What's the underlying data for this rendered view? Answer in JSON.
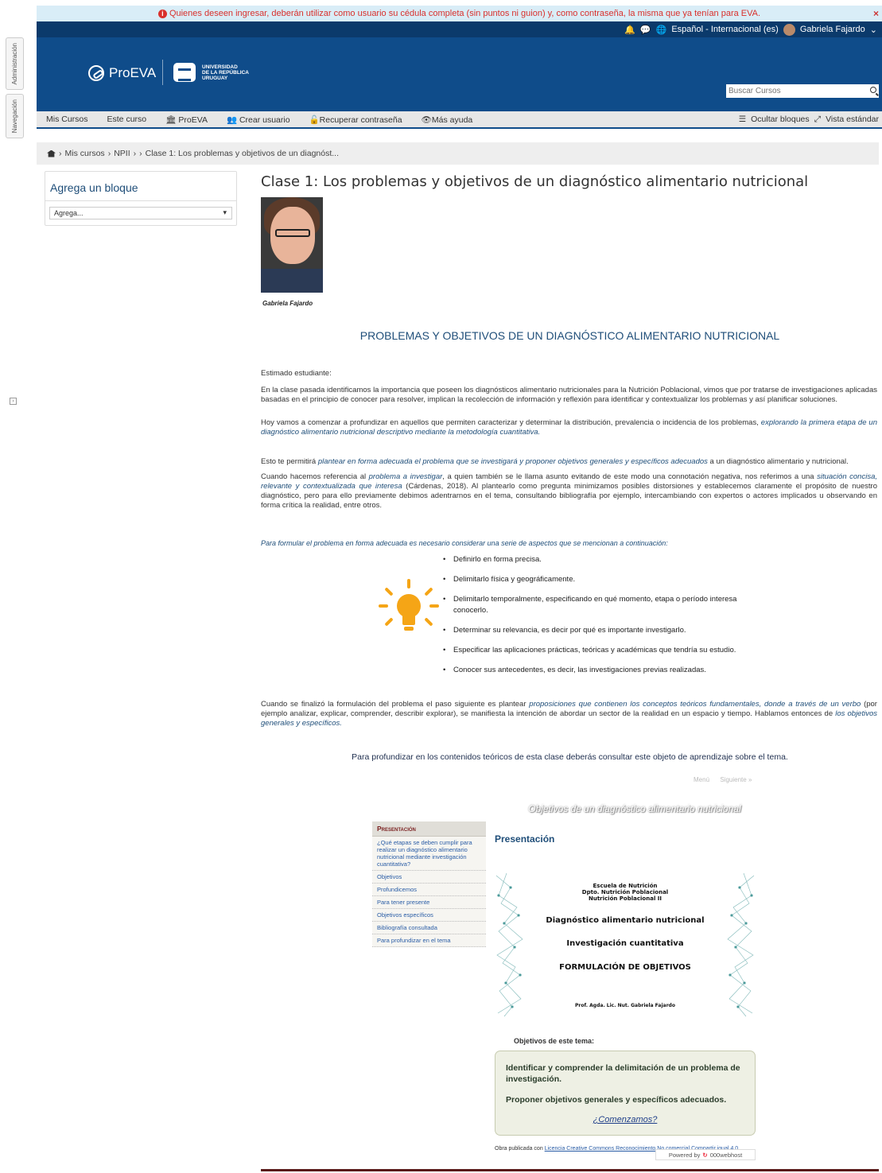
{
  "side_tabs": {
    "admin": "Administración",
    "nav": "Navegación"
  },
  "alert": {
    "text": "Quienes deseen ingresar, deberán utilizar como usuario su cédula completa (sin puntos ni guion) y, como contraseña, la misma que ya tenían para EVA.",
    "close": "×"
  },
  "topbar": {
    "language": "Español - Internacional (es)",
    "user": "Gabriela Fajardo"
  },
  "header": {
    "proeva": "ProEVA",
    "udelar_line1": "UNIVERSIDAD",
    "udelar_line2": "DE LA REPÚBLICA",
    "udelar_line3": "URUGUAY",
    "search_placeholder": "Buscar Cursos"
  },
  "menu": {
    "items": [
      "Mis Cursos",
      "Este curso",
      "ProEVA",
      "Crear usuario",
      "Recuperar contraseña",
      "Más ayuda"
    ],
    "hide_blocks": "Ocultar bloques",
    "standard_view": "Vista estándar"
  },
  "breadcrumb": {
    "items": [
      "Mis cursos",
      "NPII",
      "Clase 1: Los problemas y objetivos de un diagnóst..."
    ]
  },
  "block": {
    "title": "Agrega un bloque",
    "select": "Agrega..."
  },
  "main": {
    "title": "Clase 1: Los problemas y objetivos de un diagnóstico alimentario nutricional",
    "photo_caption": "Gabriela Fajardo",
    "heading": "PROBLEMAS Y OBJETIVOS DE UN DIAGNÓSTICO ALIMENTARIO NUTRICIONAL",
    "greeting": "Estimado estudiante:",
    "p1": "En la clase pasada identificamos la importancia que poseen los diagnósticos alimentario nutricionales para la Nutrición Poblacional, vimos que por tratarse de investigaciones aplicadas basadas en el principio de conocer para resolver,  implican la recolección de información y reflexión para identificar y contextualizar los problemas y así planificar soluciones.",
    "p2_a": "Hoy vamos a comenzar a profundizar en aquellos que permiten caracterizar y determinar la distribución, prevalencia o incidencia de los problemas, ",
    "p2_b": "explorando la primera etapa de un diagnóstico alimentario nutricional descriptivo mediante la metodología cuantitativa.",
    "p3_a": "Esto te permitirá ",
    "p3_b": "plantear en forma adecuada el problema que se investigará y proponer objetivos generales y específicos adecuados",
    "p3_c": " a un diagnóstico alimentario y nutricional.",
    "p4_a": "Cuando hacemos referencia al ",
    "p4_b": "problema a investigar",
    "p4_c": ", a quien también se le llama asunto evitando de este modo una connotación negativa, nos referimos a una ",
    "p4_d": "situación concisa, relevante y contextualizada que interesa",
    "p4_e": " (Cárdenas,  2018). Al plantearlo como pregunta minimizamos posibles distorsiones y establecemos claramente el propósito de nuestro diagnóstico, pero para ello previamente debimos adentrarnos en el tema, consultando bibliografía por ejemplo,  intercambiando con expertos o actores implicados u observando en forma crítica la realidad, entre otros.",
    "lead": "Para formular el problema en forma adecuada es necesario considerar una serie de aspectos que se mencionan a continuación:",
    "bullets": [
      "Definirlo en forma precisa.",
      "Delimitarlo física y geográficamente.",
      "Delimitarlo temporalmente, especificando en qué momento, etapa o período interesa conocerlo.",
      "Determinar su relevancia, es decir por qué es importante investigarlo.",
      "Especificar las aplicaciones prácticas, teóricas y académicas que tendría su estudio.",
      "Conocer sus antecedentes, es decir, las investigaciones previas realizadas."
    ],
    "p5_a": "Cuando se finalizó la formulación del problema el paso siguiente es plantear ",
    "p5_b": "proposiciones que contienen los conceptos teóricos fundamentales, donde a través de un verbo",
    "p5_c": " (por ejemplo analizar, explicar, comprender, describir explorar), se manifiesta la intención de abordar un sector de la realidad en un espacio y tiempo. Hablamos entonces de ",
    "p5_d": "los objetivos generales y específicos.",
    "center_note": "Para profundizar en los contenidos teóricos de esta clase deberás consultar este objeto de aprendizaje sobre el tema."
  },
  "lo": {
    "nav_menu": "Menú",
    "nav_next": "Siguiente »",
    "title": "Objetivos de un diagnóstico alimentario nutricional",
    "menu_head": "Presentación",
    "menu_items": [
      "¿Qué etapas se deben cumplir para realizar un diagnóstico alimentario nutricional mediante investigación cuantitativa?",
      "Objetivos",
      "Profundicemos",
      "Para tener presente",
      "Objetivos específicos",
      "Bibliografía consultada",
      "Para profundizar en el tema"
    ],
    "heading": "Presentación",
    "slide": {
      "school": "Escuela de Nutrición",
      "dept": "Dpto. Nutrición Poblacional",
      "course": "Nutrición Poblacional II",
      "t1": "Diagnóstico alimentario nutricional",
      "t2": "Investigación cuantitativa",
      "t3": "FORMULACIÓN DE OBJETIVOS",
      "author": "Prof. Agda. Lic. Nut. Gabriela Fajardo"
    },
    "sub": "Objetivos de este tema:",
    "obj1": "Identificar y comprender la delimitación de un problema de investigación.",
    "obj2": "Proponer objetivos generales y específicos adecuados.",
    "go": "¿Comenzamos?",
    "foot_a": "Obra publicada con ",
    "foot_link": "Licencia Creative Commons Reconocimiento No comercial Compartir igual 4.0",
    "powered": "Powered by",
    "powered_brand": "000webhost"
  }
}
